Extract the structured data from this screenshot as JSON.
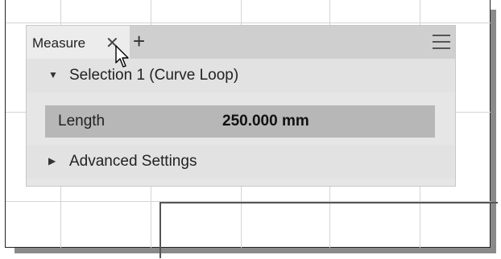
{
  "panel": {
    "tab_label": "Measure",
    "close_icon": "close-icon",
    "add_icon": "plus-icon",
    "menu_icon": "hamburger-menu-icon",
    "selection_section": {
      "title": "Selection 1 (Curve Loop)",
      "expanded": true
    },
    "result": {
      "label": "Length",
      "value": "250.000 mm"
    },
    "advanced_section": {
      "title": "Advanced Settings",
      "expanded": false
    }
  },
  "colors": {
    "header_bg": "#cfcfcf",
    "tab_bg": "#ececec",
    "section_bg": "#e2e2e2",
    "result_bg": "#b7b7b7"
  }
}
